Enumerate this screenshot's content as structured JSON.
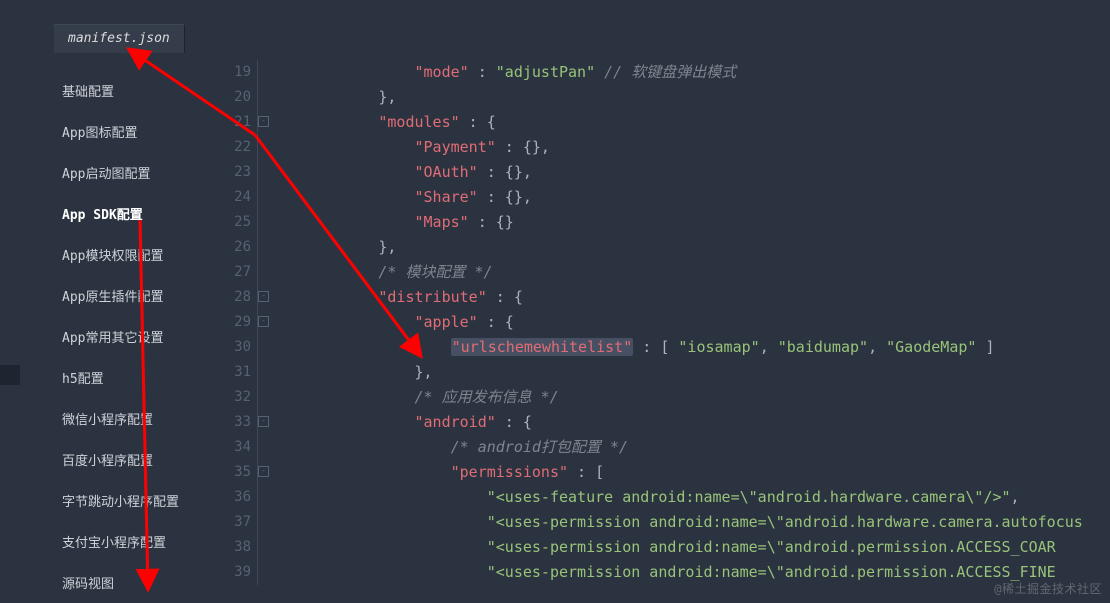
{
  "tab": {
    "filename": "manifest.json"
  },
  "sidebar": {
    "items": [
      {
        "label": "基础配置"
      },
      {
        "label": "App图标配置"
      },
      {
        "label": "App启动图配置"
      },
      {
        "label": "App SDK配置",
        "selected": true
      },
      {
        "label": "App模块权限配置"
      },
      {
        "label": "App原生插件配置"
      },
      {
        "label": "App常用其它设置"
      },
      {
        "label": "h5配置"
      },
      {
        "label": "微信小程序配置"
      },
      {
        "label": "百度小程序配置"
      },
      {
        "label": "字节跳动小程序配置"
      },
      {
        "label": "支付宝小程序配置"
      },
      {
        "label": "源码视图"
      }
    ]
  },
  "gutter": {
    "start": 19,
    "end": 39,
    "folds": [
      21,
      28,
      29,
      33,
      35
    ]
  },
  "code": {
    "l19": {
      "indent": "                ",
      "key": "mode",
      "colon": " : ",
      "val": "adjustPan",
      "tail": " // 软键盘弹出模式"
    },
    "l20": {
      "text": "            },"
    },
    "l21": {
      "indent": "            ",
      "key": "modules",
      "colon": " : {",
      "tail": ""
    },
    "l22": {
      "indent": "                ",
      "key": "Payment",
      "colon": " : {},",
      "tail": ""
    },
    "l23": {
      "indent": "                ",
      "key": "OAuth",
      "colon": " : {},",
      "tail": ""
    },
    "l24": {
      "indent": "                ",
      "key": "Share",
      "colon": " : {},",
      "tail": ""
    },
    "l25": {
      "indent": "                ",
      "key": "Maps",
      "colon": " : {}",
      "tail": ""
    },
    "l26": {
      "text": "            },"
    },
    "l27": {
      "text": "            /* 模块配置 */"
    },
    "l28": {
      "indent": "            ",
      "key": "distribute",
      "colon": " : {",
      "tail": ""
    },
    "l29": {
      "indent": "                ",
      "key": "apple",
      "colon": " : {",
      "tail": ""
    },
    "l30": {
      "indent": "                    ",
      "key": "urlschemewhitelist",
      "colon": " : [ ",
      "arr": [
        "iosamap",
        "baidumap",
        "GaodeMap"
      ],
      "tail": " ]"
    },
    "l31": {
      "text": "                },"
    },
    "l32": {
      "text": "                /* 应用发布信息 */"
    },
    "l33": {
      "indent": "                ",
      "key": "android",
      "colon": " : {",
      "tail": ""
    },
    "l34": {
      "text": "                    /* android打包配置 */"
    },
    "l35": {
      "indent": "                    ",
      "key": "permissions",
      "colon": " : [",
      "tail": ""
    },
    "l36": {
      "text": "                        ",
      "val": "<uses-feature android:name=\\\"android.hardware.camera\\\"/>",
      "comma": ","
    },
    "l37": {
      "text": "                        ",
      "val": "<uses-permission android:name=\\\"android.hardware.camera.autofocus",
      "comma": ""
    },
    "l38": {
      "text": "                        ",
      "val": "<uses-permission android:name=\\\"android.permission.ACCESS_COAR",
      "comma": ""
    },
    "l39": {
      "text": "                        ",
      "val": "<uses-permission android:name=\\\"android.permission.ACCESS_FINE",
      "comma": ""
    }
  },
  "watermark": "@稀土掘金技术社区"
}
